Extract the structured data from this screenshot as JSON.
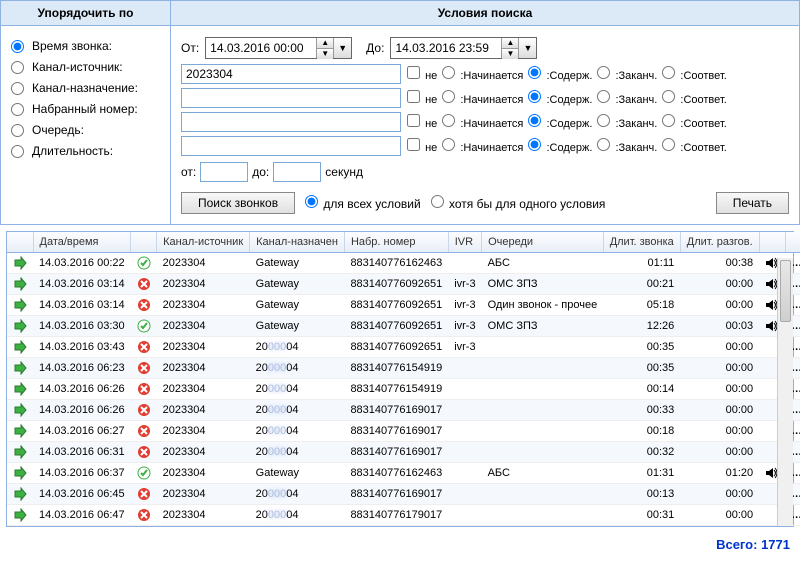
{
  "headers": {
    "sort": "Упорядочить по",
    "search": "Условия поиска"
  },
  "sort": {
    "options": [
      "Время звонка:",
      "Канал-источник:",
      "Канал-назначение:",
      "Набранный номер:",
      "Очередь:",
      "Длительность:"
    ],
    "selected": 0
  },
  "search": {
    "from_label": "От:",
    "to_label": "До:",
    "from_value": "14.03.2016 00:00",
    "to_value": "14.03.2016 23:59",
    "filters": [
      {
        "value": "2023304",
        "not": false,
        "match": "contains"
      },
      {
        "value": "",
        "not": false,
        "match": "contains"
      },
      {
        "value": "",
        "not": false,
        "match": "contains"
      },
      {
        "value": "",
        "not": false,
        "match": "contains"
      }
    ],
    "not_label": "не",
    "match_labels": {
      "starts": ":Начинается",
      "contains": ":Содерж.",
      "ends": ":Заканч.",
      "exact": ":Соответ."
    },
    "duration": {
      "from_label": "от:",
      "to_label": "до:",
      "from_value": "",
      "to_value": "",
      "unit": "секунд"
    },
    "search_button": "Поиск звонков",
    "mode_all": "для всех условий",
    "mode_any": "хотя бы для одного условия",
    "mode_selected": "all",
    "print_button": "Печать"
  },
  "grid": {
    "columns": [
      "",
      "Дата/время",
      "",
      "Канал-источник",
      "Канал-назначен",
      "Набр. номер",
      "IVR",
      "Очереди",
      "Длит. звонка",
      "Длит. разгов.",
      "",
      "",
      ""
    ],
    "rows": [
      {
        "dir": "out",
        "dt": "14.03.2016 00:22",
        "ok": true,
        "src": "2023304",
        "dst": "Gateway",
        "num": "883140776162463",
        "ivr": "",
        "q": "АБС",
        "d1": "01:11",
        "d2": "00:38",
        "snd": true
      },
      {
        "dir": "out",
        "dt": "14.03.2016 03:14",
        "ok": false,
        "src": "2023304",
        "dst": "Gateway",
        "num": "883140776092651",
        "ivr": "ivr-3",
        "q": "ОМС ЗПЗ",
        "d1": "00:21",
        "d2": "00:00",
        "snd": true
      },
      {
        "dir": "out",
        "dt": "14.03.2016 03:14",
        "ok": false,
        "src": "2023304",
        "dst": "Gateway",
        "num": "883140776092651",
        "ivr": "ivr-3",
        "q": "Один звонок - прочее",
        "d1": "05:18",
        "d2": "00:00",
        "snd": true
      },
      {
        "dir": "out",
        "dt": "14.03.2016 03:30",
        "ok": true,
        "src": "2023304",
        "dst": "Gateway",
        "num": "883140776092651",
        "ivr": "ivr-3",
        "q": "ОМС ЗПЗ",
        "d1": "12:26",
        "d2": "00:03",
        "snd": true
      },
      {
        "dir": "out",
        "dt": "14.03.2016 03:43",
        "ok": false,
        "src": "2023304",
        "dst": "2000004",
        "dstBlur": true,
        "num": "883140776092651",
        "ivr": "ivr-3",
        "q": "",
        "d1": "00:35",
        "d2": "00:00",
        "snd": false
      },
      {
        "dir": "out",
        "dt": "14.03.2016 06:23",
        "ok": false,
        "src": "2023304",
        "dst": "2000004",
        "dstBlur": true,
        "num": "883140776154919",
        "ivr": "",
        "q": "",
        "d1": "00:35",
        "d2": "00:00",
        "snd": false
      },
      {
        "dir": "out",
        "dt": "14.03.2016 06:26",
        "ok": false,
        "src": "2023304",
        "dst": "2000004",
        "dstBlur": true,
        "num": "883140776154919",
        "ivr": "",
        "q": "",
        "d1": "00:14",
        "d2": "00:00",
        "snd": false
      },
      {
        "dir": "out",
        "dt": "14.03.2016 06:26",
        "ok": false,
        "src": "2023304",
        "dst": "2000004",
        "dstBlur": true,
        "num": "883140776169017",
        "ivr": "",
        "q": "",
        "d1": "00:33",
        "d2": "00:00",
        "snd": false
      },
      {
        "dir": "out",
        "dt": "14.03.2016 06:27",
        "ok": false,
        "src": "2023304",
        "dst": "2000004",
        "dstBlur": true,
        "num": "883140776169017",
        "ivr": "",
        "q": "",
        "d1": "00:18",
        "d2": "00:00",
        "snd": false
      },
      {
        "dir": "out",
        "dt": "14.03.2016 06:31",
        "ok": false,
        "src": "2023304",
        "dst": "2000004",
        "dstBlur": true,
        "num": "883140776169017",
        "ivr": "",
        "q": "",
        "d1": "00:32",
        "d2": "00:00",
        "snd": false
      },
      {
        "dir": "out",
        "dt": "14.03.2016 06:37",
        "ok": true,
        "src": "2023304",
        "dst": "Gateway",
        "num": "883140776162463",
        "ivr": "",
        "q": "АБС",
        "d1": "01:31",
        "d2": "01:20",
        "snd": true
      },
      {
        "dir": "out",
        "dt": "14.03.2016 06:45",
        "ok": false,
        "src": "2023304",
        "dst": "2000004",
        "dstBlur": true,
        "num": "883140776169017",
        "ivr": "",
        "q": "",
        "d1": "00:13",
        "d2": "00:00",
        "snd": false
      },
      {
        "dir": "out",
        "dt": "14.03.2016 06:47",
        "ok": false,
        "src": "2023304",
        "dst": "2000004",
        "dstBlur": true,
        "num": "883140776179017",
        "ivr": "",
        "q": "",
        "d1": "00:31",
        "d2": "00:00",
        "snd": false
      }
    ]
  },
  "total": {
    "label": "Всего:",
    "value": "1771"
  }
}
